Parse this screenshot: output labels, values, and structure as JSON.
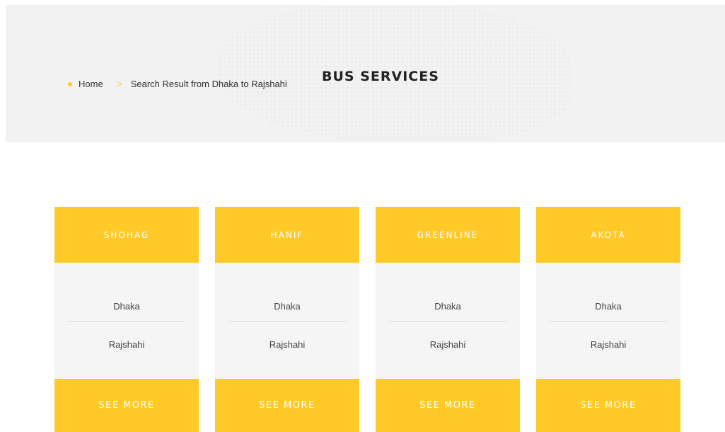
{
  "breadcrumb": {
    "home": "Home",
    "separator": ">",
    "current": "Search Result from Dhaka to Rajshahi"
  },
  "page_title": "BUS SERVICES",
  "colors": {
    "accent": "#ffca28",
    "banner_bg": "#f2f2f2",
    "card_bg": "#f5f5f5"
  },
  "cards": [
    {
      "name": "SHOHAG",
      "from": "Dhaka",
      "to": "Rajshahi",
      "button": "SEE MORE"
    },
    {
      "name": "HANIF",
      "from": "Dhaka",
      "to": "Rajshahi",
      "button": "SEE MORE"
    },
    {
      "name": "GREENLINE",
      "from": "Dhaka",
      "to": "Rajshahi",
      "button": "SEE MORE"
    },
    {
      "name": "AKOTA",
      "from": "Dhaka",
      "to": "Rajshahi",
      "button": "SEE MORE"
    }
  ]
}
